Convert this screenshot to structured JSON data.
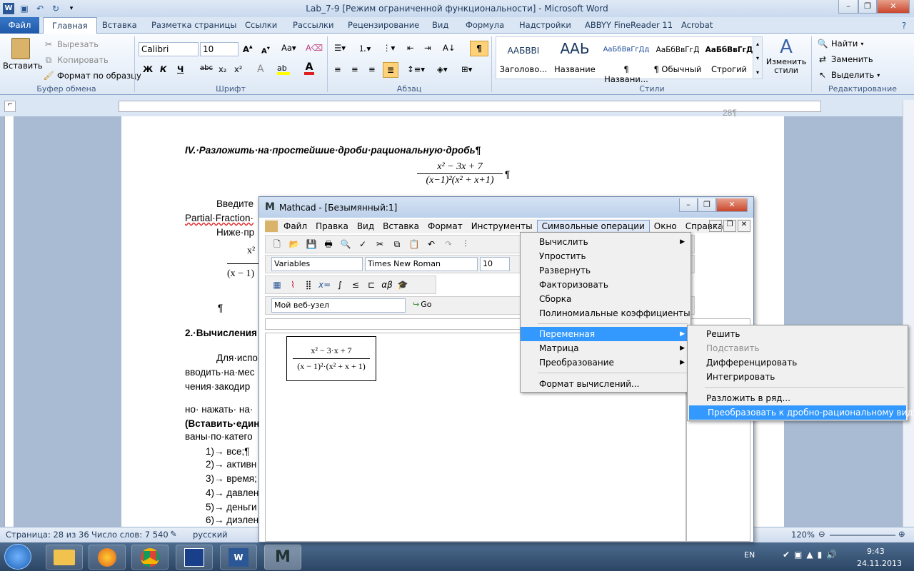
{
  "word": {
    "title": "Lab_7-9 [Режим ограниченной функциональности]  -  Microsoft Word",
    "tabs": [
      "Файл",
      "Главная",
      "Вставка",
      "Разметка страницы",
      "Ссылки",
      "Рассылки",
      "Рецензирование",
      "Вид",
      "Формула",
      "Надстройки",
      "ABBYY FineReader 11",
      "Acrobat"
    ],
    "clipboard": {
      "paste": "Вставить",
      "cut": "Вырезать",
      "copy": "Копировать",
      "format_painter": "Формат по образцу",
      "label": "Буфер обмена"
    },
    "font": {
      "name": "Calibri",
      "size": "10",
      "label": "Шрифт",
      "bold": "Ж",
      "italic": "К",
      "underline": "Ч",
      "strike": "abc",
      "sub": "x₂",
      "sup": "x²"
    },
    "paragraph": {
      "label": "Абзац"
    },
    "styles": {
      "label": "Стили",
      "items": [
        {
          "preview": "AАБBВI",
          "name": "Заголово..."
        },
        {
          "preview": "AАЬ",
          "name": "Название"
        },
        {
          "preview": "АаБбВвГгДд",
          "name": "¶ Названи..."
        },
        {
          "preview": "АаБбВвГгД",
          "name": "¶ Обычный"
        },
        {
          "preview": "АаБбВвГгД",
          "name": "Строгий"
        }
      ],
      "change": "Изменить стили"
    },
    "editing": {
      "label": "Редактирование",
      "find": "Найти",
      "replace": "Заменить",
      "select": "Выделить"
    },
    "doc": {
      "page_num": "28¶",
      "heading1": "IV.·Разложить·на·простейшие·дроби·рациональную·дробь¶",
      "frac_num": "x² − 3x + 7",
      "frac_den": "(x−1)²(x² + x+1)",
      "pilcrow": "¶",
      "line_intro": "Введите",
      "line_pf": "Partial·Fraction·",
      "line_below": "Ниже·пр",
      "frac2_num": "x²",
      "frac2_den": "(x − 1)",
      "heading2": "2.·Вычисления",
      "p1": "Для·испо",
      "p2": "вводить·на·мес",
      "p3": "чения·закодир",
      "p4": "но· нажать· на·",
      "p5": "(Вставить·един",
      "p6": "ваны·по·катего",
      "list": [
        "1)→ все;¶",
        "2)→ активн",
        "3)→ время;",
        "4)→ давлен",
        "5)→ деньги",
        "6)→ диэлен"
      ]
    },
    "status": {
      "page": "Страница: 28 из 36",
      "words": "Число слов: 7 540",
      "lang": "русский",
      "zoom": "120%"
    },
    "clock": {
      "time": "9:43",
      "date": "24.11.2013",
      "lang": "EN"
    }
  },
  "mathcad": {
    "title": "Mathcad - [Безымянный:1]",
    "menu": [
      "Файл",
      "Правка",
      "Вид",
      "Вставка",
      "Формат",
      "Инструменты",
      "Символьные операции",
      "Окно",
      "Справка"
    ],
    "style_combo": "Variables",
    "font_combo": "Times New Roman",
    "size_combo": "10",
    "web_combo": "Мой веб-узел",
    "go": "Go",
    "expr_num": "x² − 3·x + 7",
    "expr_den": "(x − 1)²·(x² + x + 1)",
    "symbolic_menu": [
      {
        "label": "Вычислить",
        "arrow": true
      },
      {
        "label": "Упростить"
      },
      {
        "label": "Развернуть"
      },
      {
        "label": "Факторизовать"
      },
      {
        "label": "Сборка"
      },
      {
        "label": "Полиномиальные коэффициенты"
      },
      {
        "label": "Переменная",
        "arrow": true,
        "highlight": true
      },
      {
        "label": "Матрица",
        "arrow": true
      },
      {
        "label": "Преобразование",
        "arrow": true
      },
      {
        "label": "Формат вычислений..."
      }
    ],
    "variable_menu": [
      {
        "label": "Решить"
      },
      {
        "label": "Подставить",
        "disabled": true
      },
      {
        "label": "Дифференцировать"
      },
      {
        "label": "Интегрировать"
      },
      {
        "label": "Разложить в ряд..."
      },
      {
        "label": "Преобразовать к дробно-рациональному виду",
        "highlight": true
      }
    ]
  }
}
